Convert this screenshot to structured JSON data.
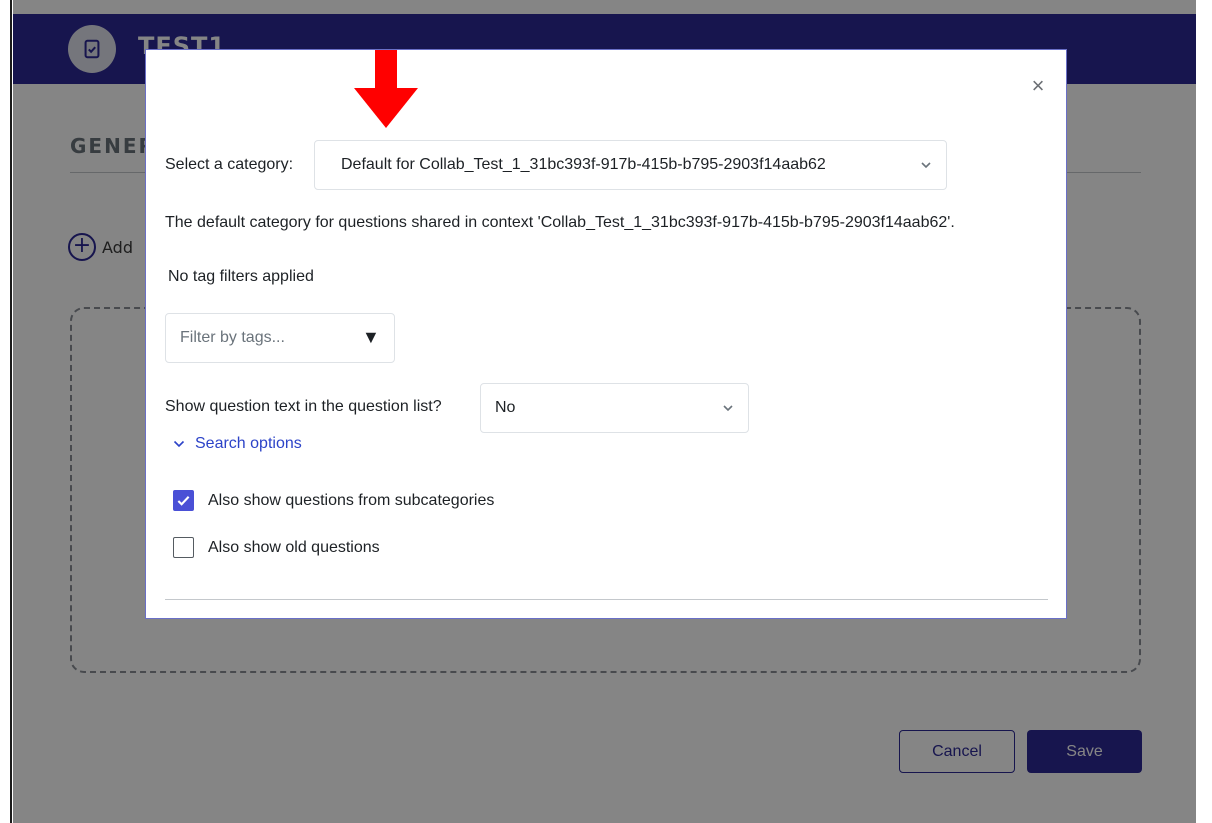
{
  "page": {
    "header_title": "TEST1",
    "section_title": "GENERAL",
    "add_label": "Add",
    "cancel_label": "Cancel",
    "save_label": "Save"
  },
  "modal": {
    "close_label": "×",
    "category": {
      "label": "Select a category:",
      "selected": "Default for Collab_Test_1_31bc393f-917b-415b-b795-2903f14aab62",
      "description": "The default category for questions shared in context 'Collab_Test_1_31bc393f-917b-415b-b795-2903f14aab62'."
    },
    "tags": {
      "status": "No tag filters applied",
      "placeholder": "Filter by tags...",
      "caret": "▼"
    },
    "show_question_text": {
      "label": "Show question text in the question list?",
      "selected": "No"
    },
    "search_options": {
      "label": "Search options",
      "checkboxes": [
        {
          "label": "Also show questions from subcategories",
          "checked": true
        },
        {
          "label": "Also show old questions",
          "checked": false
        }
      ]
    }
  },
  "colors": {
    "brand": "#2c2996",
    "link": "#2c43c8",
    "checkbox": "#4a50d6",
    "annotation_arrow": "#ff0000"
  },
  "icons": {
    "header": "quiz-icon",
    "add": "plus-circle-icon",
    "close": "close-icon",
    "dropdown": "chevron-down-icon",
    "annotation": "red-arrow-down-icon"
  }
}
